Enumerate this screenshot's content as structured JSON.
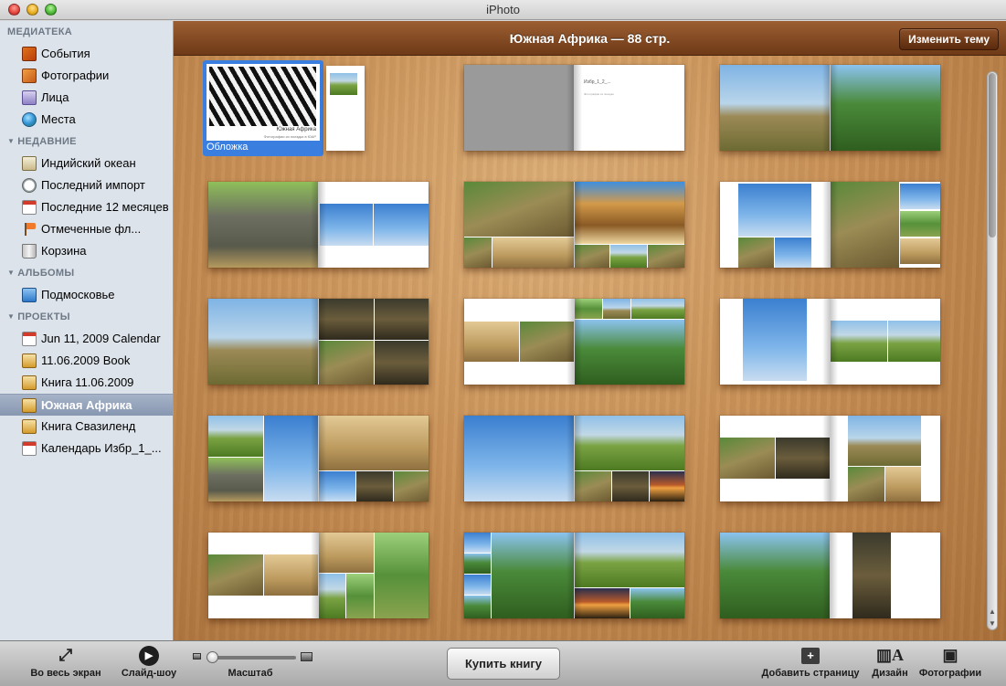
{
  "window": {
    "title": "iPhoto"
  },
  "sidebar": {
    "sections": [
      {
        "title": "МЕДИАТЕКА",
        "collapsible": false,
        "items": [
          {
            "label": "События",
            "icon": "events-icon"
          },
          {
            "label": "Фотографии",
            "icon": "photos-icon"
          },
          {
            "label": "Лица",
            "icon": "faces-icon"
          },
          {
            "label": "Места",
            "icon": "places-globe-icon"
          }
        ]
      },
      {
        "title": "НЕДАВНИЕ",
        "collapsible": true,
        "items": [
          {
            "label": "Индийский океан",
            "icon": "book-icon"
          },
          {
            "label": "Последний импорт",
            "icon": "clock-icon"
          },
          {
            "label": "Последние 12 месяцев",
            "icon": "calendar-icon"
          },
          {
            "label": "Отмеченные фл...",
            "icon": "flag-icon"
          },
          {
            "label": "Корзина",
            "icon": "trash-icon"
          }
        ]
      },
      {
        "title": "АЛЬБОМЫ",
        "collapsible": true,
        "items": [
          {
            "label": "Подмосковье",
            "icon": "album-icon"
          }
        ]
      },
      {
        "title": "ПРОЕКТЫ",
        "collapsible": true,
        "items": [
          {
            "label": "Jun 11, 2009 Calendar",
            "icon": "calendar-project-icon"
          },
          {
            "label": "11.06.2009 Book",
            "icon": "book-project-icon"
          },
          {
            "label": "Книга 11.06.2009",
            "icon": "book-project-icon"
          },
          {
            "label": "Южная Африка",
            "icon": "book-project-icon",
            "selected": true
          },
          {
            "label": "Книга Свазиленд",
            "icon": "book-project-icon"
          },
          {
            "label": "Календарь Избр_1_...",
            "icon": "calendar-project-icon"
          }
        ]
      }
    ]
  },
  "main": {
    "header_title": "Южная Африка — 88 стр.",
    "change_theme_button": "Изменить тему",
    "cover": {
      "badge": "Обложка",
      "book_title": "Южная Африка",
      "book_subtitle": "Фотографии из поездки в ЮАР"
    },
    "second_spread_caption": "Избр_1_2_...",
    "second_spread_caption_sub": "Фотографии из поездки",
    "spread_count_visible": 15
  },
  "toolbar": {
    "fullscreen": "Во весь экран",
    "slideshow": "Слайд-шоу",
    "zoom": "Масштаб",
    "buy_book": "Купить книгу",
    "add_page": "Добавить страницу",
    "design": "Дизайн",
    "photos": "Фотографии"
  },
  "colors": {
    "sidebar_bg": "#dde3ea",
    "selection": "#8797b1",
    "header_bar": "#7a4320",
    "wood": "#c89158",
    "cover_selection": "#3a7ee0"
  }
}
